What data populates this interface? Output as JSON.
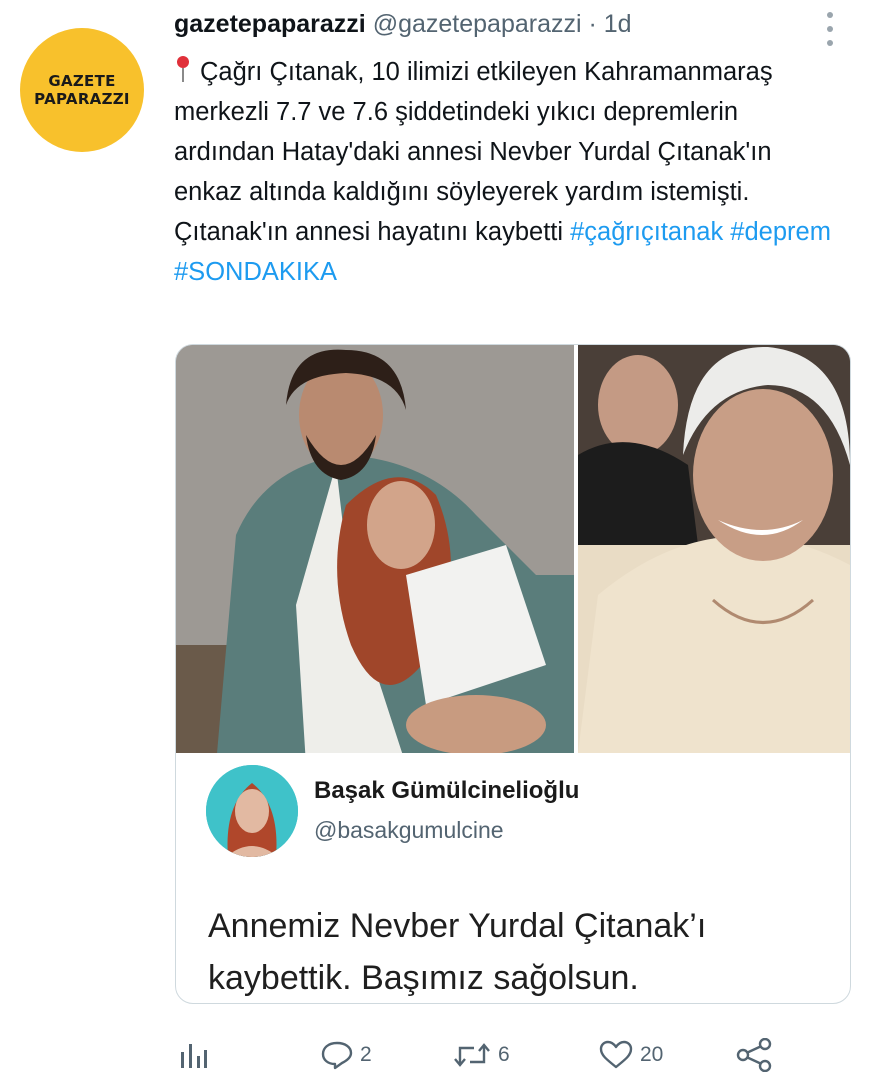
{
  "account": {
    "avatar_text_line1": "GAZETE",
    "avatar_text_line2": "PAPARAZZI",
    "display_name": "gazetepaparazzi",
    "handle": "@gazetepaparazzi",
    "separator": "·",
    "time": "1d"
  },
  "tweet": {
    "text": "Çağrı Çıtanak, 10 ilimizi etkileyen Kahramanmaraş merkezli 7.7 ve 7.6 şiddetindeki yıkıcı depremlerin ardından Hatay'daki annesi Nevber Yurdal Çıtanak'ın enkaz altında kaldığını söyleyerek yardım istemişti. Çıtanak'ın annesi hayatını kaybetti ",
    "hashtags": [
      "#çağrıçıtanak",
      "#deprem",
      "#SONDAKIKA"
    ]
  },
  "quote": {
    "name": "Başak Gümülcinelioğlu",
    "handle": "@basakgumulcine",
    "text": "Annemiz Nevber Yurdal Çitanak’ı kaybettik. Başımız sağolsun."
  },
  "actions": {
    "replies": "2",
    "retweets": "6",
    "likes": "20"
  },
  "icons": {
    "header": [
      "more-vertical-icon"
    ],
    "actions": [
      "analytics-icon",
      "reply-icon",
      "retweet-icon",
      "like-icon",
      "share-icon"
    ]
  },
  "colors": {
    "accent": "#1d9bf0",
    "avatar_bg": "#f8c12c",
    "secondary_text": "#536471"
  }
}
